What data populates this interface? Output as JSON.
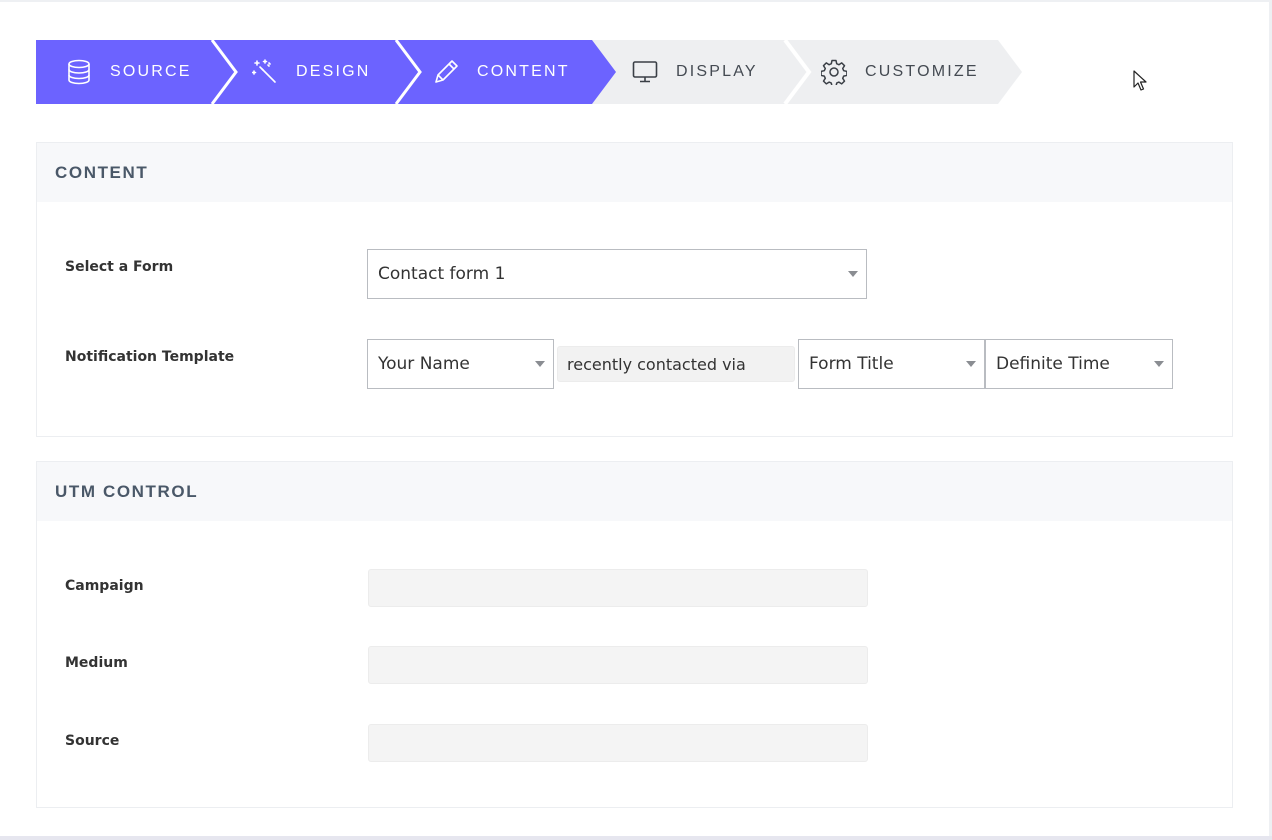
{
  "stepper": {
    "steps": [
      {
        "label": "SOURCE",
        "icon": "database-icon",
        "active": true
      },
      {
        "label": "DESIGN",
        "icon": "magic-wand-icon",
        "active": true
      },
      {
        "label": "CONTENT",
        "icon": "pencil-icon",
        "active": true
      },
      {
        "label": "DISPLAY",
        "icon": "monitor-icon",
        "active": false
      },
      {
        "label": "CUSTOMIZE",
        "icon": "gear-icon",
        "active": false
      }
    ],
    "active_color": "#6c63ff",
    "inactive_color": "#eeeff1"
  },
  "content_panel": {
    "title": "CONTENT",
    "select_form_label": "Select a Form",
    "select_form_value": "Contact form 1",
    "notification_label": "Notification Template",
    "template_name_value": "Your Name",
    "template_static_text": "recently contacted via",
    "template_title_value": "Form Title",
    "template_time_value": "Definite Time"
  },
  "utm_panel": {
    "title": "UTM CONTROL",
    "campaign_label": "Campaign",
    "campaign_value": "",
    "medium_label": "Medium",
    "medium_value": "",
    "source_label": "Source",
    "source_value": ""
  }
}
